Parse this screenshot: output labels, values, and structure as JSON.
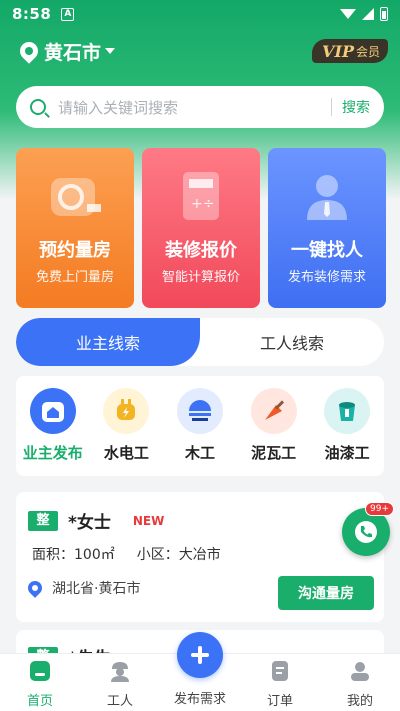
{
  "status_bar": {
    "time": "8:58",
    "notif_letter": "A"
  },
  "header": {
    "city": "黄石市",
    "vip_main": "VIP",
    "vip_sub": "会员"
  },
  "search": {
    "placeholder": "请输入关键词搜索",
    "button": "搜索"
  },
  "feature_cards": [
    {
      "title": "预约量房",
      "subtitle": "免费上门量房",
      "icon": "measuring-tape-icon"
    },
    {
      "title": "装修报价",
      "subtitle": "智能计算报价",
      "icon": "calculator-icon"
    },
    {
      "title": "一键找人",
      "subtitle": "发布装修需求",
      "icon": "person-icon"
    }
  ],
  "tabs": [
    {
      "label": "业主线索"
    },
    {
      "label": "工人线索"
    }
  ],
  "categories": [
    {
      "label": "业主发布",
      "icon": "house-icon"
    },
    {
      "label": "水电工",
      "icon": "plug-icon"
    },
    {
      "label": "木工",
      "icon": "saw-icon"
    },
    {
      "label": "泥瓦工",
      "icon": "trowel-icon"
    },
    {
      "label": "油漆工",
      "icon": "paint-bucket-icon"
    }
  ],
  "leads": [
    {
      "badge": "整",
      "name": "*女士",
      "tag": "NEW",
      "area_label": "面积：100㎡",
      "community_label": "小区：大冶市",
      "location": "湖北省·黄石市",
      "action": "沟通量房"
    },
    {
      "badge": "整",
      "name": "*先生"
    }
  ],
  "float_phone": {
    "count": "99+"
  },
  "bottom_nav": [
    {
      "label": "首页",
      "icon": "home-icon"
    },
    {
      "label": "工人",
      "icon": "worker-icon"
    },
    {
      "label": "发布需求",
      "icon": "plus-icon"
    },
    {
      "label": "订单",
      "icon": "order-icon"
    },
    {
      "label": "我的",
      "icon": "profile-icon"
    }
  ],
  "colors": {
    "brand_green": "#1aae6c",
    "accent_blue": "#3c73f6",
    "orange": "#f47b22",
    "red": "#f1495a",
    "new_red": "#e8393b"
  }
}
